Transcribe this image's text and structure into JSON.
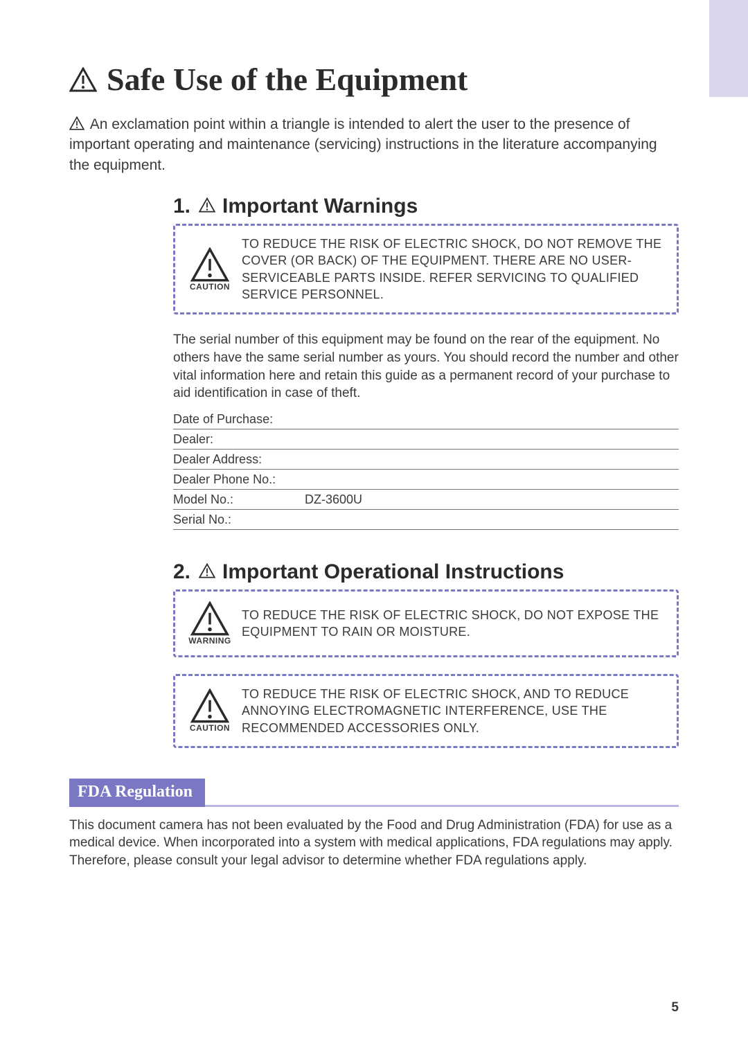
{
  "title": "Safe Use of the Equipment",
  "intro": "An exclamation point within a triangle is intended to alert the user to the presence of important operating and maintenance (servicing) instructions in the literature accompanying the equipment.",
  "section1": {
    "number": "1.",
    "heading": "Important Warnings",
    "caution_label": "CAUTION",
    "caution_text": "TO REDUCE THE RISK OF ELECTRIC SHOCK, DO NOT REMOVE THE COVER (OR BACK) OF THE EQUIPMENT. THERE ARE NO USER-SERVICEABLE PARTS INSIDE. REFER SERVICING TO QUALIFIED SERVICE PERSONNEL.",
    "serial_text": "The serial number of this equipment may be found on the rear of the equipment. No others have the same serial number as yours. You should record the number and other vital information here and retain this guide as a permanent record of your purchase to aid identification in case of theft.",
    "records": [
      {
        "label": "Date of Purchase:",
        "value": ""
      },
      {
        "label": "Dealer:",
        "value": ""
      },
      {
        "label": "Dealer Address:",
        "value": ""
      },
      {
        "label": "Dealer Phone No.:",
        "value": ""
      },
      {
        "label": "Model No.:",
        "value": "DZ-3600U"
      },
      {
        "label": "Serial No.:",
        "value": ""
      }
    ]
  },
  "section2": {
    "number": "2.",
    "heading": "Important Operational Instructions",
    "warning_label": "WARNING",
    "warning_text": "TO REDUCE THE RISK OF ELECTRIC SHOCK, DO NOT EXPOSE THE EQUIPMENT TO RAIN OR MOISTURE.",
    "caution_label": "CAUTION",
    "caution_text": "TO REDUCE THE RISK OF ELECTRIC SHOCK, AND TO REDUCE ANNOYING ELECTROMAGNETIC INTERFERENCE, USE THE RECOMMENDED ACCESSORIES ONLY."
  },
  "fda": {
    "title": "FDA Regulation",
    "text": "This document camera has not been evaluated by the Food and Drug Administration (FDA) for use as a medical device. When incorporated into a system with medical applications, FDA regulations may apply. Therefore, please consult your legal advisor to determine whether FDA regulations apply."
  },
  "page_number": "5"
}
